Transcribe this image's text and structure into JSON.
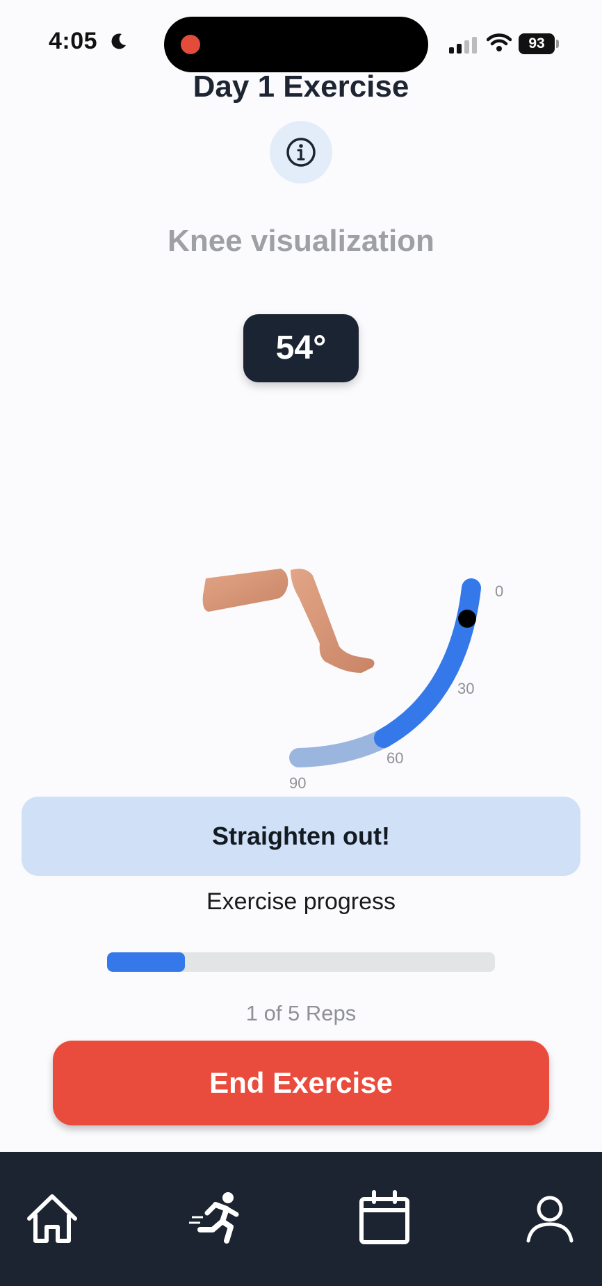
{
  "status_bar": {
    "time": "4:05",
    "battery": "93"
  },
  "header": {
    "title": "Day 1 Exercise"
  },
  "visualization": {
    "title": "Knee visualization",
    "angle_display": "54°",
    "current_angle": 54,
    "scale_ticks": [
      "0",
      "30",
      "60",
      "90"
    ],
    "active_range": [
      0,
      60
    ]
  },
  "instruction": {
    "text": "Straighten out!"
  },
  "progress": {
    "label": "Exercise progress",
    "completed": 1,
    "total": 5,
    "fraction": 0.2,
    "reps_text": "1 of 5 Reps"
  },
  "actions": {
    "end_label": "End Exercise"
  },
  "colors": {
    "accent": "#3478ea",
    "danger": "#e94c3d",
    "dark": "#1b2430",
    "card": "#cfe0f7"
  },
  "tab_bar": {
    "icons": [
      "home-icon",
      "running-icon",
      "calendar-icon",
      "profile-icon"
    ]
  }
}
